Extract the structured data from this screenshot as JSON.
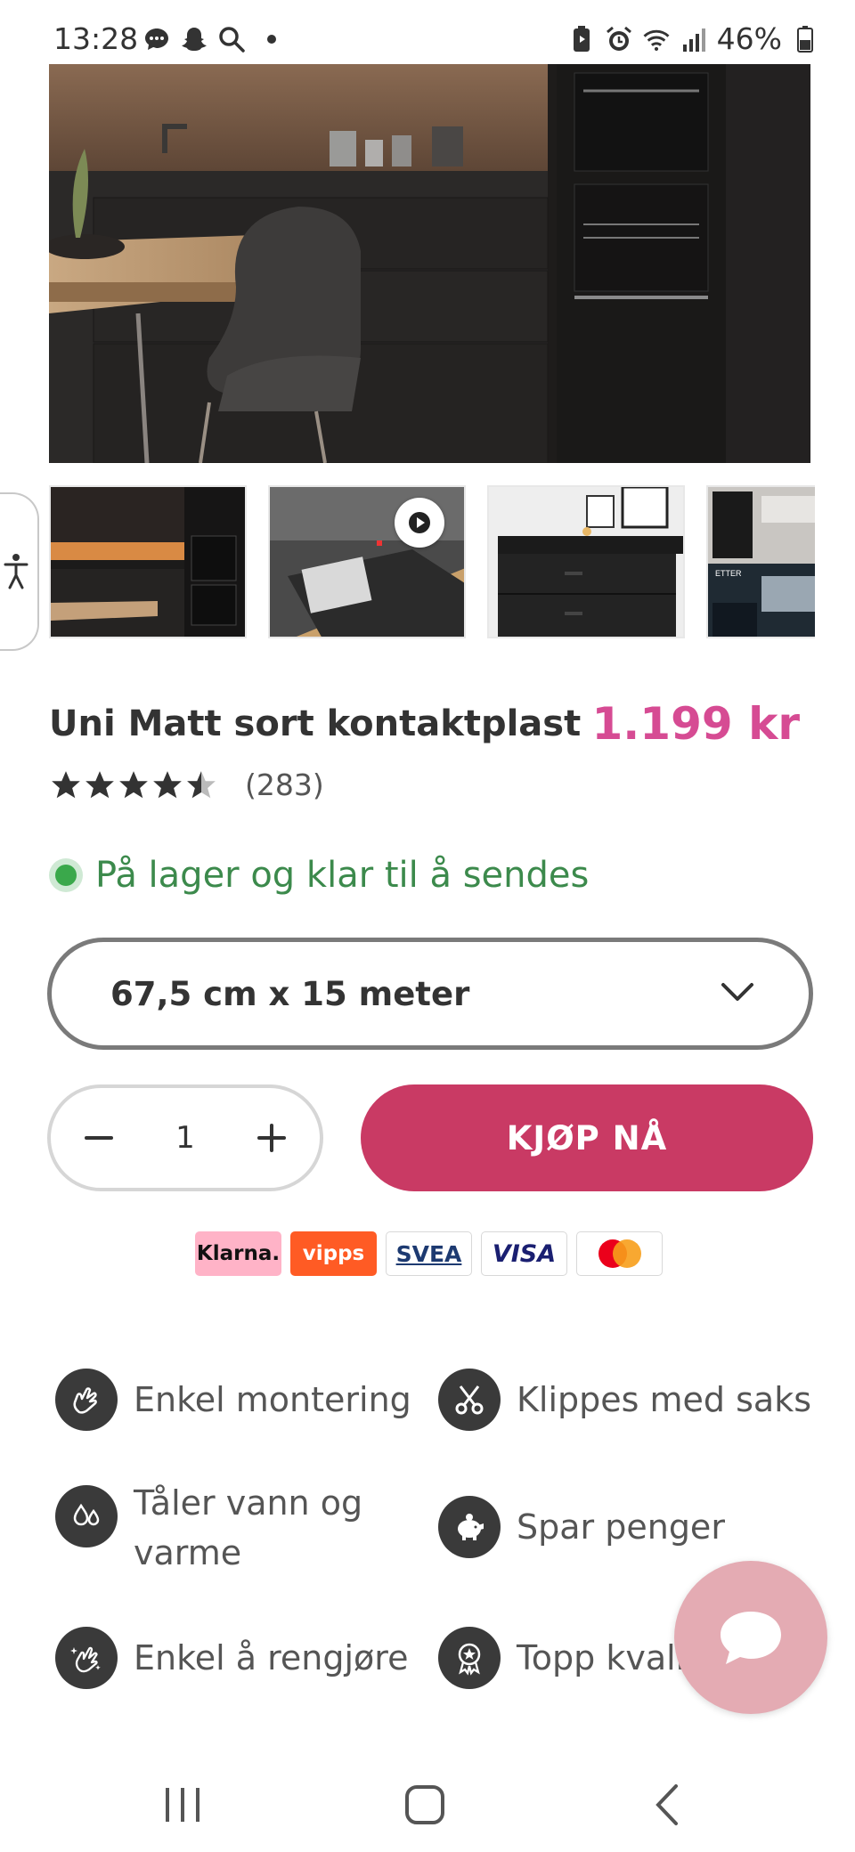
{
  "status_bar": {
    "time": "13:28",
    "battery": "46%",
    "left_icons": [
      "messages-icon",
      "snapchat-icon",
      "search-icon"
    ],
    "right_icons": [
      "battery-saver-icon",
      "alarm-icon",
      "wifi-icon",
      "signal-icon",
      "battery-icon"
    ]
  },
  "gallery": {
    "thumbnails": [
      "kitchen-thumbnail",
      "video-thumbnail",
      "dresser-thumbnail",
      "before-after-thumbnail"
    ],
    "thumbnail_badge": "ETTER"
  },
  "product": {
    "title": "Uni Matt sort kontaktplast",
    "price": "1.199 kr",
    "rating": 4.5,
    "review_count": "(283)",
    "stock_text": "På lager og klar til å sendes",
    "size_selected": "67,5 cm x 15 meter",
    "quantity": "1",
    "buy_label": "KJØP NÅ"
  },
  "payments": {
    "klarna": "Klarna.",
    "vipps": "vipps",
    "svea": "SVEA",
    "visa": "VISA"
  },
  "features": [
    {
      "label": "Enkel montering",
      "icon": "hand-gesture-icon"
    },
    {
      "label": "Klippes med saks",
      "icon": "scissors-icon"
    },
    {
      "label": "Tåler vann og varme",
      "icon": "water-drops-icon"
    },
    {
      "label": "Spar penger",
      "icon": "piggy-bank-icon"
    },
    {
      "label": "Enkel å rengjøre",
      "icon": "cleaning-hand-icon"
    },
    {
      "label": "Topp kvalitet",
      "icon": "quality-badge-icon"
    }
  ],
  "colors": {
    "price": "#d64b93",
    "buy_button": "#c93a64",
    "stock_green": "#3c8a4c",
    "chat_bubble": "#e4abb3"
  }
}
